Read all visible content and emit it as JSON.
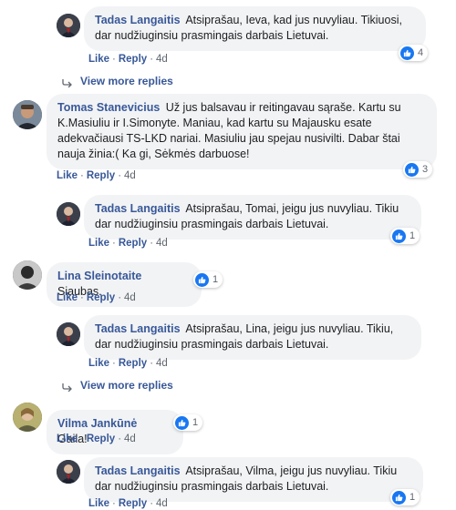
{
  "comments": [
    {
      "author": "Tadas Langaitis",
      "text": "Atsiprašau, Ieva, kad jus nuvyliau. Tikiuosi, dar nudžiuginsiu prasmingais darbais Lietuvai.",
      "reactions": "4",
      "like": "Like",
      "reply": "Reply",
      "time": "4d"
    },
    {
      "author": "Tomas Stanevicius",
      "text": "Už jus balsavau ir reitingavau sąraše. Kartu su K.Masiuliu ir I.Simonyte. Maniau, kad kartu su Majausku esate adekvačiausi TS-LKD nariai. Masiuliu jau spejau nusivilti. Dabar štai nauja žinia:( Ka gi, Sėkmės darbuose!",
      "reactions": "3",
      "like": "Like",
      "reply": "Reply",
      "time": "4d"
    },
    {
      "author": "Tadas Langaitis",
      "text": "Atsiprašau, Tomai, jeigu jus nuvyliau. Tikiu dar nudžiuginsiu prasmingais darbais Lietuvai.",
      "reactions": "1",
      "like": "Like",
      "reply": "Reply",
      "time": "4d"
    },
    {
      "author": "Lina Sleinotaite",
      "text": "Siaubas.",
      "reactions": "1",
      "like": "Like",
      "reply": "Reply",
      "time": "4d"
    },
    {
      "author": "Tadas Langaitis",
      "text": "Atsiprašau, Lina, jeigu jus nuvyliau. Tikiu, dar nudžiuginsiu prasmingais darbais Lietuvai.",
      "reactions": "",
      "like": "Like",
      "reply": "Reply",
      "time": "4d"
    },
    {
      "author": "Vilma Jankūnė",
      "text": "Gaila!",
      "reactions": "1",
      "like": "Like",
      "reply": "Reply",
      "time": "4d"
    },
    {
      "author": "Tadas Langaitis",
      "text": "Atsiprašau, Vilma, jeigu jus nuvyliau. Tikiu dar nudžiuginsiu prasmingais darbais Lietuvai.",
      "reactions": "1",
      "like": "Like",
      "reply": "Reply",
      "time": "4d"
    }
  ],
  "view_more_1": "View more replies",
  "view_more_2": "View more replies",
  "colors": {
    "link": "#385898",
    "bubble": "#f2f3f5",
    "like_blue": "#1877f2"
  }
}
